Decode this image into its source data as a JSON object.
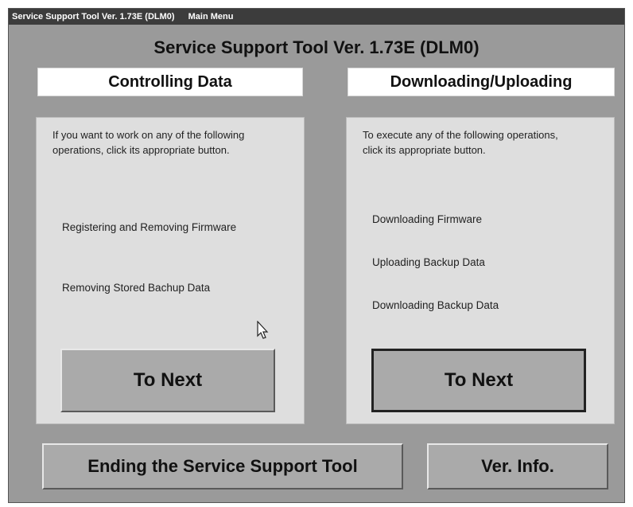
{
  "window": {
    "title": "Service Support Tool Ver. 1.73E (DLM0)",
    "menu_label": "Main Menu"
  },
  "heading": "Service Support Tool Ver. 1.73E (DLM0)",
  "left_panel": {
    "header": "Controlling Data",
    "intro": "If you want to work on any of the following operations, click its appropriate button.",
    "operations": [
      "Registering and Removing Firmware",
      "Removing Stored Bachup Data"
    ],
    "button_label": "To Next"
  },
  "right_panel": {
    "header": "Downloading/Uploading",
    "intro": "To execute any of the following operations, click its appropriate button.",
    "operations": [
      "Downloading Firmware",
      "Uploading Backup Data",
      "Downloading Backup Data"
    ],
    "button_label": "To Next"
  },
  "bottom": {
    "end_label": "Ending the Service Support Tool",
    "ver_label": "Ver. Info."
  },
  "icons": {
    "cursor": "mouse-pointer-icon"
  },
  "colors": {
    "window_bg": "#9a9a9a",
    "panel_bg": "#dedede",
    "button_bg": "#aaaaaa",
    "titlebar_bg": "#3c3c3c"
  }
}
